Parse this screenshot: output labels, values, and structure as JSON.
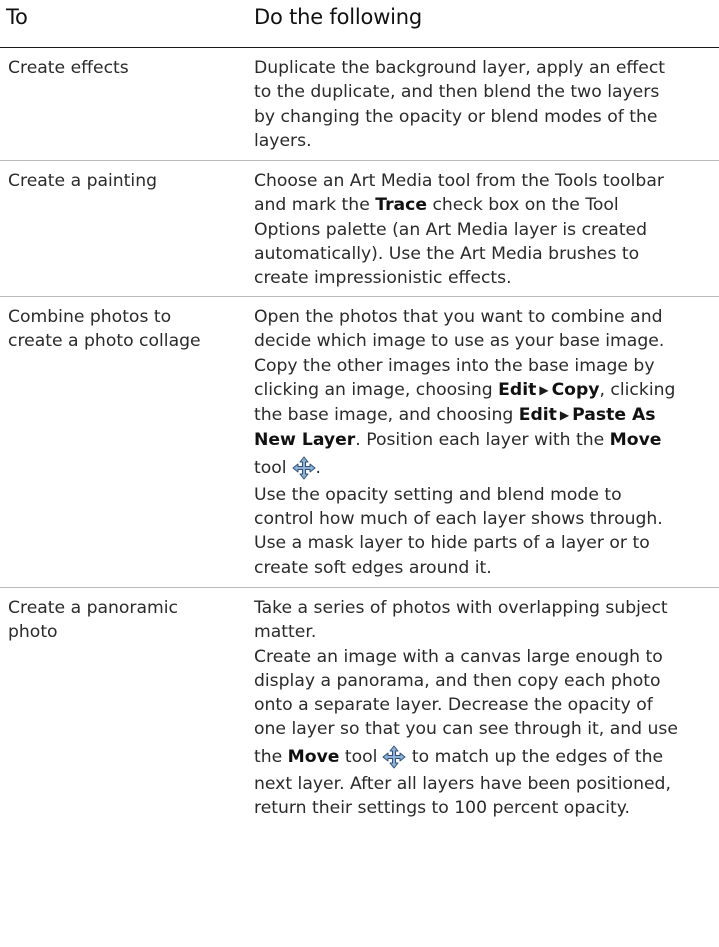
{
  "header": {
    "col_to": "To",
    "col_do": "Do the following"
  },
  "rows": [
    {
      "to": "Create effects",
      "do_lines": [
        "Duplicate the background layer, apply an effect",
        "to the duplicate, and then blend the two layers",
        "by changing the opacity or blend modes of the",
        "layers."
      ]
    },
    {
      "to": "Create a painting",
      "do": {
        "l1": "Choose an Art Media tool from the Tools toolbar",
        "l2a": "and mark the ",
        "l2b": "Trace",
        "l2c": " check box on the Tool",
        "l3": "Options palette (an Art Media layer is created",
        "l4": "automatically). Use the Art Media brushes to",
        "l5": "create impressionistic effects."
      }
    },
    {
      "to_lines": [
        "Combine photos to",
        "create a photo collage"
      ],
      "do": {
        "l1": "Open the photos that you want to combine and",
        "l2": "decide which image to use as your base image.",
        "l3": "Copy the other images into the base image by",
        "l4a": "clicking an image, choosing ",
        "l4b": "Edit",
        "l4c": "Copy",
        "l4d": ", clicking",
        "l5a": "the base image, and choosing ",
        "l5b": "Edit",
        "l5c": "Paste As",
        "l6a": "New Layer",
        "l6b": ". Position each layer with the ",
        "l6c": "Move",
        "l7a": "tool",
        "l7b": ".",
        "l8": "Use the opacity setting and blend mode to",
        "l9": "control how much of each layer shows through.",
        "l10": "Use a mask layer to hide parts of a layer or to",
        "l11": "create soft edges around it."
      }
    },
    {
      "to_lines": [
        "Create a panoramic",
        "photo"
      ],
      "do": {
        "l1": "Take a series of photos with overlapping subject",
        "l2": "matter.",
        "l3": "Create an image with a canvas large enough to",
        "l4": "display a panorama, and then copy each photo",
        "l5": "onto a separate layer. Decrease the opacity of",
        "l6": "one layer so that you can see through it, and use",
        "l7a": "the ",
        "l7b": "Move",
        "l7c": " tool",
        "l7d": " to match up the edges of the",
        "l8": "next layer. After all layers have been positioned,",
        "l9": "return their settings to 100 percent opacity."
      }
    }
  ],
  "glyphs": {
    "menu_arrow": "▶"
  },
  "icons": {
    "move_tool": "move-tool-icon"
  },
  "colors": {
    "text": "#2a2a2a",
    "rule": "#bcbcbc",
    "header_rule": "#1a1a1a",
    "icon_fill": "#8fb2d6",
    "icon_stroke": "#2f4f74"
  }
}
